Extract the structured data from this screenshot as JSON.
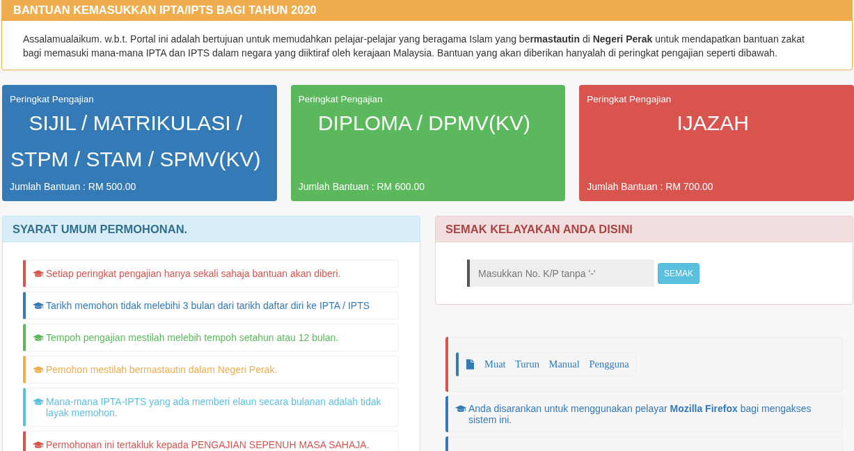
{
  "intro": {
    "title": "BANTUAN KEMASUKKAN IPTA/IPTS BAGI TAHUN 2020",
    "text": "Assalamualaikum. w.b.t. Portal ini adalah bertujuan untuk memudahkan pelajar-pelajar yang beragama Islam yang be**rmastautin** di **Negeri Perak** untuk mendapatkan bantuan zakat bagi memasuki mana-mana IPTA dan IPTS dalam negara yang diiktiraf oleh kerajaan Malaysia. Bantuan yang akan diberikan hanyalah di peringkat pengajian seperti dibawah."
  },
  "levels": [
    {
      "label": "Peringkat Pengajian",
      "name": "SIJIL / MATRIKULASI / STPM / STAM / SPMV(KV)",
      "amount": "Jumlah Bantuan : RM 500.00",
      "color": "#337ab7"
    },
    {
      "label": "Peringkat Pengajian",
      "name": "DIPLOMA / DPMV(KV)",
      "amount": "Jumlah Bantuan : RM 600.00",
      "color": "#5cb85c"
    },
    {
      "label": "Peringkat Pengajian",
      "name": "IJAZAH",
      "amount": "Jumlah Bantuan : RM 700.00",
      "color": "#d9534f"
    }
  ],
  "requirements": {
    "title": "SYARAT UMUM PERMOHONAN.",
    "items": [
      {
        "text": "Setiap peringkat pengajian hanya sekali sahaja bantuan akan diberi.",
        "color": "#d9534f"
      },
      {
        "text": "Tarikh memohon tidak melebihi 3 bulan dari tarikh daftar diri ke IPTA / IPTS",
        "color": "#337ab7"
      },
      {
        "text": "Tempoh pengajian mestilah melebih tempoh setahun atau 12 bulan.",
        "color": "#5cb85c"
      },
      {
        "text": "Pemohon mestilah bermastautin dalam Negeri Perak.",
        "color": "#f0ad4e"
      },
      {
        "text": "Mana-mana IPTA-IPTS yang ada memberi elaun secara bulanan adalah tidak layak memohon.",
        "color": "#5bc0de"
      },
      {
        "text": "Permohonan ini tertakluk kepada PENGAJIAN SEPENUH MASA SAHAJA.",
        "color": "#d9534f"
      }
    ]
  },
  "eligibility": {
    "title": "SEMAK KELAYAKAN ANDA DISINI",
    "field": {
      "placeholder": "Masukkan No. K/P tanpa '-'"
    },
    "button": "SEMAK"
  },
  "notices": [
    {
      "kind": "download",
      "color": "#d9534f",
      "link": {
        "text": "Muat Turun Manual Pengguna",
        "color": "#337ab7"
      }
    },
    {
      "kind": "message",
      "color": "#337ab7",
      "text": "Anda disarankan untuk menggunakan pelayar **Mozilla Firefox** bagi mengakses sistem ini."
    },
    {
      "kind": "cut",
      "color": "#337ab7"
    }
  ]
}
